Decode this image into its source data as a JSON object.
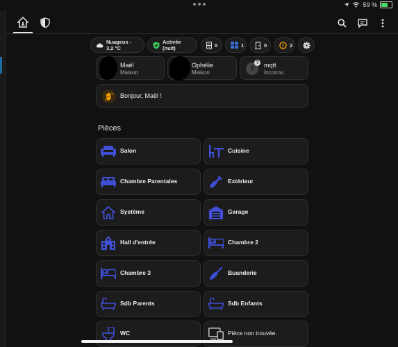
{
  "status_bar": {
    "battery_text": "59 %"
  },
  "chips": {
    "weather": "Nuageux - 3,2 °C",
    "alarm": "Activée (nuit)",
    "count_a": "0",
    "count_b": "1",
    "count_c": "0",
    "count_d": "2"
  },
  "persons": [
    {
      "name": "Maël",
      "state": "Maison"
    },
    {
      "name": "Ophélie",
      "state": "Maison"
    },
    {
      "name": "mqtt",
      "state": "Inconnu"
    }
  ],
  "greeting": "Bonjour, Maël !",
  "section_title": "Pièces",
  "rooms": [
    {
      "label": "Salon",
      "icon": "sofa-icon"
    },
    {
      "label": "Cuisine",
      "icon": "table-chair-icon"
    },
    {
      "label": "Chambre Parentales",
      "icon": "bed-icon"
    },
    {
      "label": "Extérieur",
      "icon": "shovel-icon"
    },
    {
      "label": "Système",
      "icon": "home-icon"
    },
    {
      "label": "Garage",
      "icon": "garage-icon"
    },
    {
      "label": "Hall d'entrée",
      "icon": "building-icon"
    },
    {
      "label": "Chambre 2",
      "icon": "bed-icon"
    },
    {
      "label": "Chambre 3",
      "icon": "bed-icon"
    },
    {
      "label": "Buanderie",
      "icon": "broom-icon"
    },
    {
      "label": "Sdb Parents",
      "icon": "bathtub-icon"
    },
    {
      "label": "Sdb Enfants",
      "icon": "bathtub-icon"
    },
    {
      "label": "WC",
      "icon": "toilet-icon"
    },
    {
      "label": "Pièce non trouvée.",
      "icon": "devices-icon"
    }
  ],
  "colors": {
    "accent_blue": "#3f4fd6",
    "alarm_green": "#3cc45a",
    "warning_orange": "#f2a300",
    "card_bg": "#1c1c1c"
  }
}
